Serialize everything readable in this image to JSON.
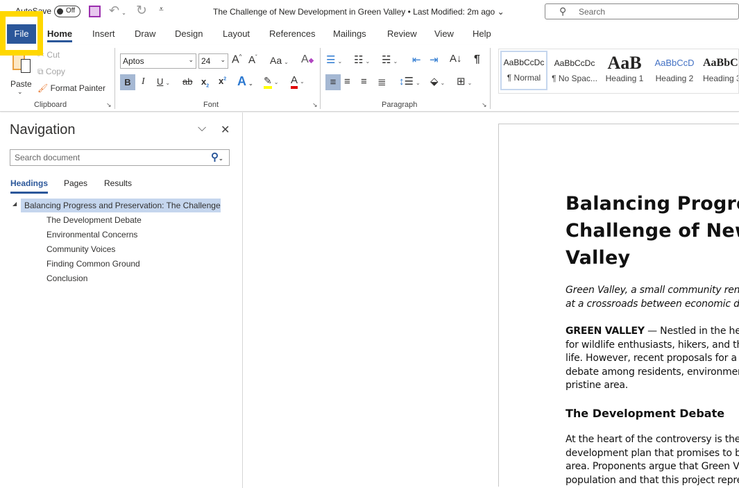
{
  "titlebar": {
    "autosave_label": "AutoSave",
    "autosave_state": "Off",
    "title": "The Challenge of New Development in Green Valley",
    "separator": "•",
    "modified": "Last Modified: 2m ago",
    "search_placeholder": "Search"
  },
  "tabs": [
    "File",
    "Home",
    "Insert",
    "Draw",
    "Design",
    "Layout",
    "References",
    "Mailings",
    "Review",
    "View",
    "Help"
  ],
  "active_tab": "Home",
  "highlight_color": "#ffd700",
  "accent": "#2b579a",
  "ribbon": {
    "clipboard": {
      "paste": "Paste",
      "cut": "Cut",
      "copy": "Copy",
      "format_painter": "Format Painter",
      "label": "Clipboard"
    },
    "font": {
      "name": "Aptos",
      "size": "24",
      "change_case": "Aa",
      "label": "Font",
      "bold": "B",
      "italic": "I",
      "underline": "U",
      "strike": "ab"
    },
    "paragraph": {
      "label": "Paragraph"
    },
    "styles": [
      {
        "preview": "AaBbCcDc",
        "name": "¶ Normal"
      },
      {
        "preview": "AaBbCcDc",
        "name": "¶ No Spac..."
      },
      {
        "preview": "AaB",
        "name": "Heading 1"
      },
      {
        "preview": "AaBbCcD",
        "name": "Heading 2"
      },
      {
        "preview": "AaBbC",
        "name": "Heading 3"
      }
    ]
  },
  "navigation": {
    "title": "Navigation",
    "search_placeholder": "Search document",
    "tabs": [
      "Headings",
      "Pages",
      "Results"
    ],
    "active_tab": "Headings",
    "root": "Balancing Progress and Preservation: The Challenge...",
    "items": [
      "The Development Debate",
      "Environmental Concerns",
      "Community Voices",
      "Finding Common Ground",
      "Conclusion"
    ]
  },
  "document": {
    "title_lines": [
      "Balancing Progress and Preservation: The",
      "Challenge of New Development in Green",
      "Valley"
    ],
    "subtitle_lines": [
      "Green Valley, a small community renowned",
      "at a crossroads between economic development"
    ],
    "lead_bold": "GREEN VALLEY",
    "lead_lines": [
      "— Nestled in the heart of",
      "for wildlife enthusiasts, hikers, and those",
      "life. However, recent proposals for a large",
      "debate among residents, environmentalists",
      "pristine area."
    ],
    "section_heading": "The Development Debate",
    "section_lines": [
      "At the heart of the controversy is the proposed",
      "development plan that promises to bring",
      "area. Proponents argue that Green Valley",
      "population and that this project represents"
    ]
  }
}
